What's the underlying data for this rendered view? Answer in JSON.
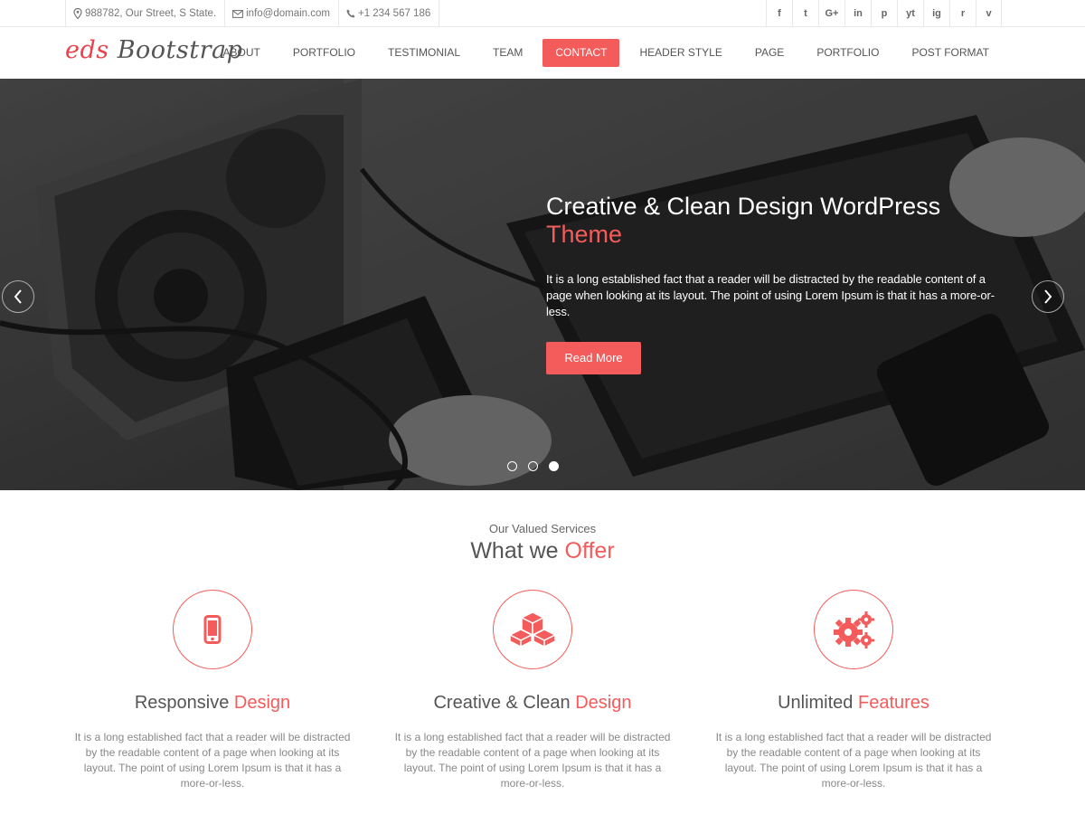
{
  "topbar": {
    "address": "988782, Our Street, S State.",
    "email": "info@domain.com",
    "phone": "+1 234 567 186",
    "social": [
      {
        "icon": "facebook-icon",
        "glyph": "f"
      },
      {
        "icon": "twitter-icon",
        "glyph": "t"
      },
      {
        "icon": "google-plus-icon",
        "glyph": "G+"
      },
      {
        "icon": "linkedin-icon",
        "glyph": "in"
      },
      {
        "icon": "pinterest-icon",
        "glyph": "p"
      },
      {
        "icon": "youtube-icon",
        "glyph": "yt"
      },
      {
        "icon": "instagram-icon",
        "glyph": "ig"
      },
      {
        "icon": "reddit-icon",
        "glyph": "r"
      },
      {
        "icon": "vimeo-icon",
        "glyph": "v"
      }
    ]
  },
  "header": {
    "logo_accent": "eds",
    "logo_rest": " Bootstrap",
    "nav": [
      "ABOUT",
      "PORTFOLIO",
      "TESTIMONIAL",
      "TEAM",
      "CONTACT",
      "HEADER STYLE",
      "PAGE",
      "PORTFOLIO",
      "POST FORMAT"
    ],
    "active_index": 4
  },
  "hero": {
    "title": "Creative & Clean Design WordPress",
    "title_accent": "Theme",
    "text": "It is a long established fact that a reader will be distracted by the readable content of a page when looking at its layout. The point of using Lorem Ipsum is that it has a more-or-less.",
    "button": "Read More",
    "slides": 3,
    "active_slide": 3
  },
  "services": {
    "eyebrow": "Our Valued Services",
    "title": "What we",
    "title_accent": "Offer",
    "items": [
      {
        "icon": "mobile-phone-icon",
        "title": "Responsive",
        "title_accent": "Design",
        "text": "It is a long established fact that a reader will be distracted by the readable content of a page when looking at its layout. The point of using Lorem Ipsum is that it has a more-or-less."
      },
      {
        "icon": "cubes-icon",
        "title": "Creative & Clean",
        "title_accent": "Design",
        "text": "It is a long established fact that a reader will be distracted by the readable content of a page when looking at its layout. The point of using Lorem Ipsum is that it has a more-or-less."
      },
      {
        "icon": "gears-icon",
        "title": "Unlimited",
        "title_accent": "Features",
        "text": "It is a long established fact that a reader will be distracted by the readable content of a page when looking at its layout. The point of using Lorem Ipsum is that it has a more-or-less."
      }
    ]
  },
  "colors": {
    "accent": "#f45b5b",
    "text": "#555555",
    "muted": "#888888"
  }
}
